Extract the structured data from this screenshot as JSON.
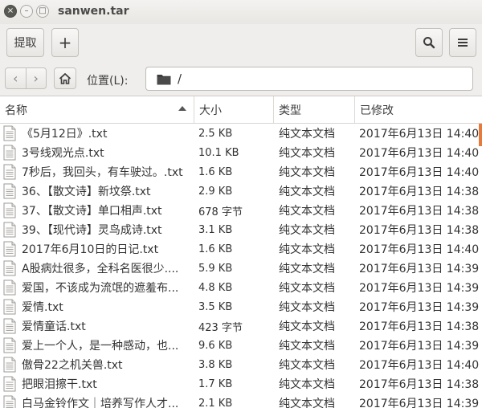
{
  "window": {
    "title": "sanwen.tar",
    "close_glyph": "×",
    "minimize_glyph": "–",
    "maximize_glyph": "□"
  },
  "toolbar": {
    "extract_label": "提取",
    "add_glyph": "+",
    "search_icon": "search-icon",
    "menu_icon": "hamburger-menu-icon"
  },
  "location": {
    "back_glyph": "‹",
    "forward_glyph": "›",
    "label": "位置(L):",
    "path": "/"
  },
  "columns": {
    "name": "名称",
    "size": "大小",
    "type": "类型",
    "modified": "已修改"
  },
  "colors": {
    "accent": "#e6793b",
    "header_border": "#d8d5d1",
    "toolbar_bg": "#efeeec"
  },
  "files": [
    {
      "name": "《5月12日》.txt",
      "size": "2.5 KB",
      "type": "纯文本文档",
      "modified": "2017年6月13日 14:40"
    },
    {
      "name": "3号线观光点.txt",
      "size": "10.1 KB",
      "type": "纯文本文档",
      "modified": "2017年6月13日 14:40"
    },
    {
      "name": "7秒后，我回头，有车驶过。.txt",
      "size": "1.6 KB",
      "type": "纯文本文档",
      "modified": "2017年6月13日 14:40"
    },
    {
      "name": "36、【散文诗】新坟祭.txt",
      "size": "2.9 KB",
      "type": "纯文本文档",
      "modified": "2017年6月13日 14:38"
    },
    {
      "name": "37、【散文诗】单口相声.txt",
      "size": "678 字节",
      "type": "纯文本文档",
      "modified": "2017年6月13日 14:38"
    },
    {
      "name": "39、【现代诗】灵鸟成诗.txt",
      "size": "3.1 KB",
      "type": "纯文本文档",
      "modified": "2017年6月13日 14:38"
    },
    {
      "name": "2017年6月10日的日记.txt",
      "size": "1.6 KB",
      "type": "纯文本文档",
      "modified": "2017年6月13日 14:40"
    },
    {
      "name": "A股病灶很多，全科名医很少....",
      "size": "5.9 KB",
      "type": "纯文本文档",
      "modified": "2017年6月13日 14:39"
    },
    {
      "name": "爱国，不该成为流氓的遮羞布...",
      "size": "4.8 KB",
      "type": "纯文本文档",
      "modified": "2017年6月13日 14:39"
    },
    {
      "name": "爱情.txt",
      "size": "3.5 KB",
      "type": "纯文本文档",
      "modified": "2017年6月13日 14:39"
    },
    {
      "name": "爱情童话.txt",
      "size": "423 字节",
      "type": "纯文本文档",
      "modified": "2017年6月13日 14:38"
    },
    {
      "name": "爱上一个人，是一种感动，也...",
      "size": "9.6 KB",
      "type": "纯文本文档",
      "modified": "2017年6月13日 14:39"
    },
    {
      "name": "傲骨22之机关兽.txt",
      "size": "3.8 KB",
      "type": "纯文本文档",
      "modified": "2017年6月13日 14:40"
    },
    {
      "name": "把眼泪擦干.txt",
      "size": "1.7 KB",
      "type": "纯文本文档",
      "modified": "2017年6月13日 14:38"
    },
    {
      "name": "白马金铃作文｜培养写作人才...",
      "size": "2.1 KB",
      "type": "纯文本文档",
      "modified": "2017年6月13日 14:39"
    }
  ]
}
